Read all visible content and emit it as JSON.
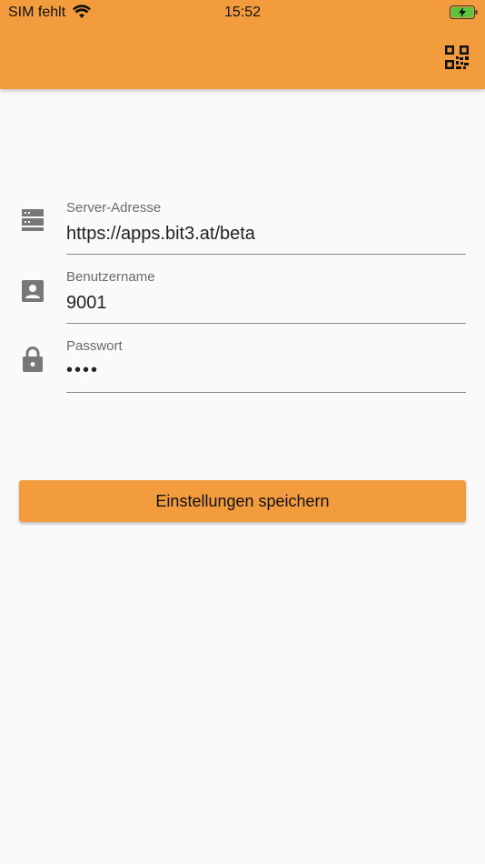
{
  "status_bar": {
    "carrier": "SIM fehlt",
    "time": "15:52"
  },
  "app_bar": {
    "qr_icon": "qr-code-icon",
    "color": "#f29c3e"
  },
  "form": {
    "server": {
      "label": "Server-Adresse",
      "value": "https://apps.bit3.at/beta",
      "icon": "server-icon"
    },
    "username": {
      "label": "Benutzername",
      "value": "9001",
      "icon": "account-box-icon"
    },
    "password": {
      "label": "Passwort",
      "value": "••••",
      "icon": "lock-icon"
    }
  },
  "save_button": {
    "label": "Einstellungen speichern"
  }
}
